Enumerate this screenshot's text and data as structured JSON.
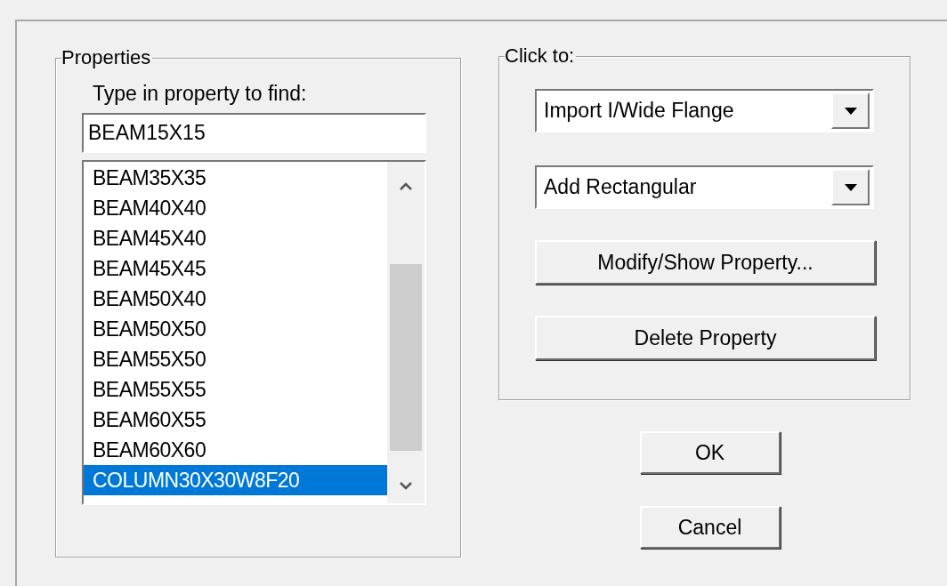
{
  "properties_group": {
    "title": "Properties",
    "search_label": "Type in property to find:",
    "search_value": "BEAM15X15",
    "items": [
      {
        "label": "BEAM35X35",
        "selected": false
      },
      {
        "label": "BEAM40X40",
        "selected": false
      },
      {
        "label": "BEAM45X40",
        "selected": false
      },
      {
        "label": "BEAM45X45",
        "selected": false
      },
      {
        "label": "BEAM50X40",
        "selected": false
      },
      {
        "label": "BEAM50X50",
        "selected": false
      },
      {
        "label": "BEAM55X50",
        "selected": false
      },
      {
        "label": "BEAM55X55",
        "selected": false
      },
      {
        "label": "BEAM60X55",
        "selected": false
      },
      {
        "label": "BEAM60X60",
        "selected": false
      },
      {
        "label": "COLUMN30X30W8F20",
        "selected": true
      }
    ]
  },
  "actions_group": {
    "title": "Click to:",
    "controls": [
      {
        "kind": "dropdown",
        "label": "Import I/Wide Flange"
      },
      {
        "kind": "dropdown",
        "label": "Add Rectangular"
      },
      {
        "kind": "button",
        "label": "Modify/Show Property..."
      },
      {
        "kind": "button",
        "label": "Delete Property"
      }
    ]
  },
  "buttons": [
    "OK",
    "Cancel"
  ]
}
